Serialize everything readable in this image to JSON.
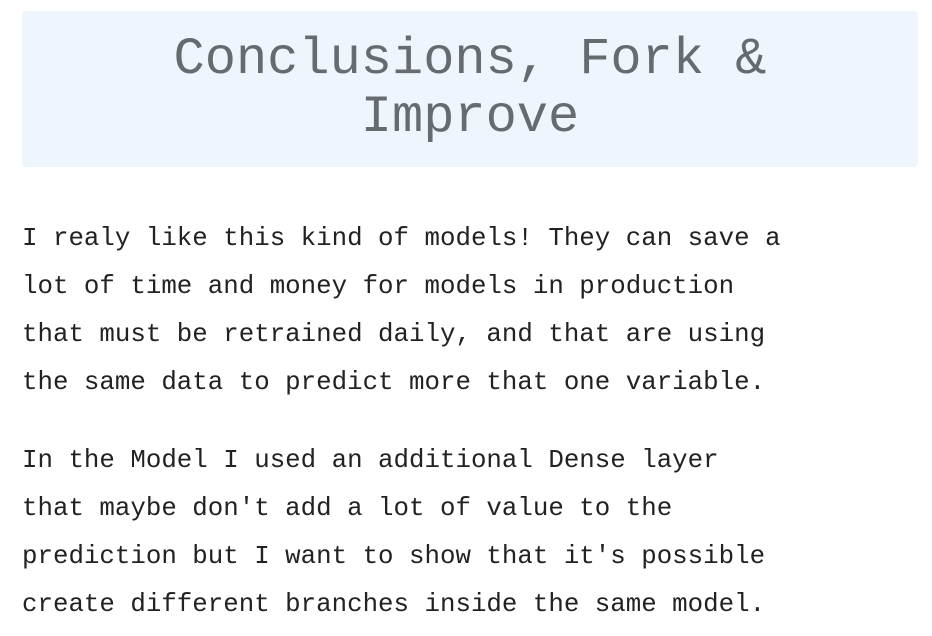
{
  "header": {
    "title": "Conclusions, Fork & Improve"
  },
  "body": {
    "paragraphs": [
      "I realy like this kind of models! They can save a\nlot of time and money for models in production\nthat must be retrained daily, and that are using\nthe same data to predict more that one variable.",
      "In the Model I used an additional Dense layer\nthat maybe don't add a lot of value to the\nprediction but I want to show that it's possible\ncreate different branches inside the same model."
    ]
  }
}
